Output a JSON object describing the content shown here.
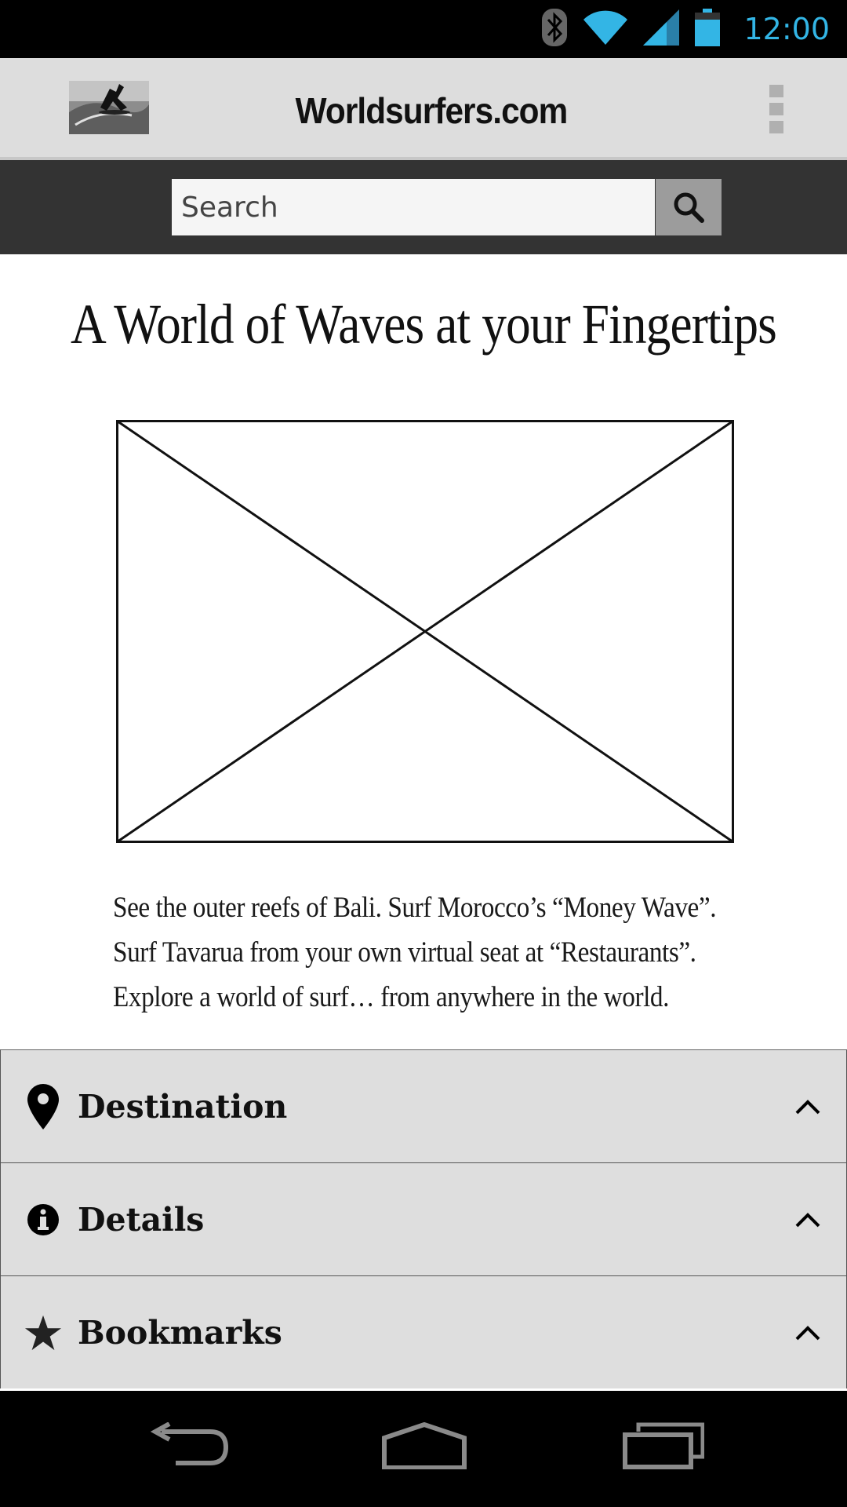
{
  "status_bar": {
    "time": "12:00",
    "icons": [
      "bluetooth-icon",
      "wifi-icon",
      "cell-signal-icon",
      "battery-icon"
    ],
    "accent_color": "#33b5e5"
  },
  "header": {
    "title": "Worldsurfers.com",
    "logo": "surfer-logo-image",
    "menu_icon": "overflow-menu-icon"
  },
  "search": {
    "placeholder": "Search",
    "button_icon": "search-icon"
  },
  "main": {
    "headline": "A World of Waves at your Fingertips",
    "image": "image-placeholder",
    "description_lines": [
      "See the outer reefs of Bali. Surf Morocco’s “Money Wave”.",
      "Surf Tavarua from your own virtual seat at “Restaurants”.",
      "Explore a world of surf… from anywhere in the world."
    ]
  },
  "accordion": [
    {
      "label": "Destination",
      "icon": "map-pin-icon",
      "chevron": "chevron-up-icon"
    },
    {
      "label": "Details",
      "icon": "info-icon",
      "chevron": "chevron-up-icon"
    },
    {
      "label": "Bookmarks",
      "icon": "star-icon",
      "chevron": "chevron-up-icon"
    }
  ],
  "nav_bar": {
    "buttons": [
      "back-icon",
      "home-icon",
      "recent-apps-icon"
    ]
  }
}
